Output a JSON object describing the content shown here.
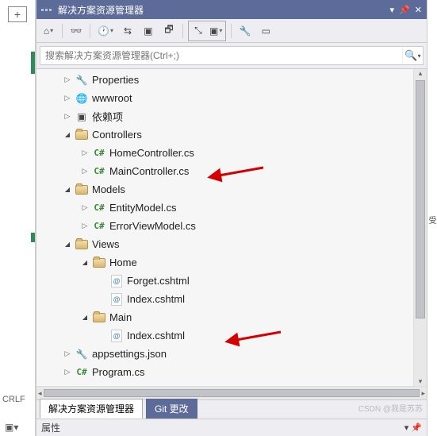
{
  "title": "解决方案资源管理器",
  "search": {
    "placeholder": "搜索解决方案资源管理器(Ctrl+;)"
  },
  "tabs": {
    "solution": "解决方案资源管理器",
    "git": "Git 更改"
  },
  "props_title": "属性",
  "crlf": "CRLF",
  "watermark": "CSDN @我是苏苏",
  "right_strip": "受",
  "tree": [
    {
      "depth": 1,
      "exp": "collapsed",
      "icon": "wrench",
      "label": "Properties"
    },
    {
      "depth": 1,
      "exp": "collapsed",
      "icon": "globe",
      "label": "wwwroot"
    },
    {
      "depth": 1,
      "exp": "collapsed",
      "icon": "dep",
      "label": "依赖项"
    },
    {
      "depth": 1,
      "exp": "expanded",
      "icon": "folder",
      "label": "Controllers"
    },
    {
      "depth": 2,
      "exp": "collapsed",
      "icon": "cs",
      "label": "HomeController.cs"
    },
    {
      "depth": 2,
      "exp": "collapsed",
      "icon": "cs",
      "label": "MainController.cs",
      "arrow": true
    },
    {
      "depth": 1,
      "exp": "expanded",
      "icon": "folder",
      "label": "Models"
    },
    {
      "depth": 2,
      "exp": "collapsed",
      "icon": "cs",
      "label": "EntityModel.cs"
    },
    {
      "depth": 2,
      "exp": "collapsed",
      "icon": "cs",
      "label": "ErrorViewModel.cs"
    },
    {
      "depth": 1,
      "exp": "expanded",
      "icon": "folder",
      "label": "Views"
    },
    {
      "depth": 2,
      "exp": "expanded",
      "icon": "folder",
      "label": "Home"
    },
    {
      "depth": 3,
      "exp": "none",
      "icon": "cshtml",
      "label": "Forget.cshtml"
    },
    {
      "depth": 3,
      "exp": "none",
      "icon": "cshtml",
      "label": "Index.cshtml"
    },
    {
      "depth": 2,
      "exp": "expanded",
      "icon": "folder",
      "label": "Main"
    },
    {
      "depth": 3,
      "exp": "none",
      "icon": "cshtml",
      "label": "Index.cshtml",
      "arrow": true
    },
    {
      "depth": 1,
      "exp": "collapsed",
      "icon": "json",
      "label": "appsettings.json"
    },
    {
      "depth": 1,
      "exp": "collapsed",
      "icon": "cs",
      "label": "Program.cs"
    }
  ]
}
